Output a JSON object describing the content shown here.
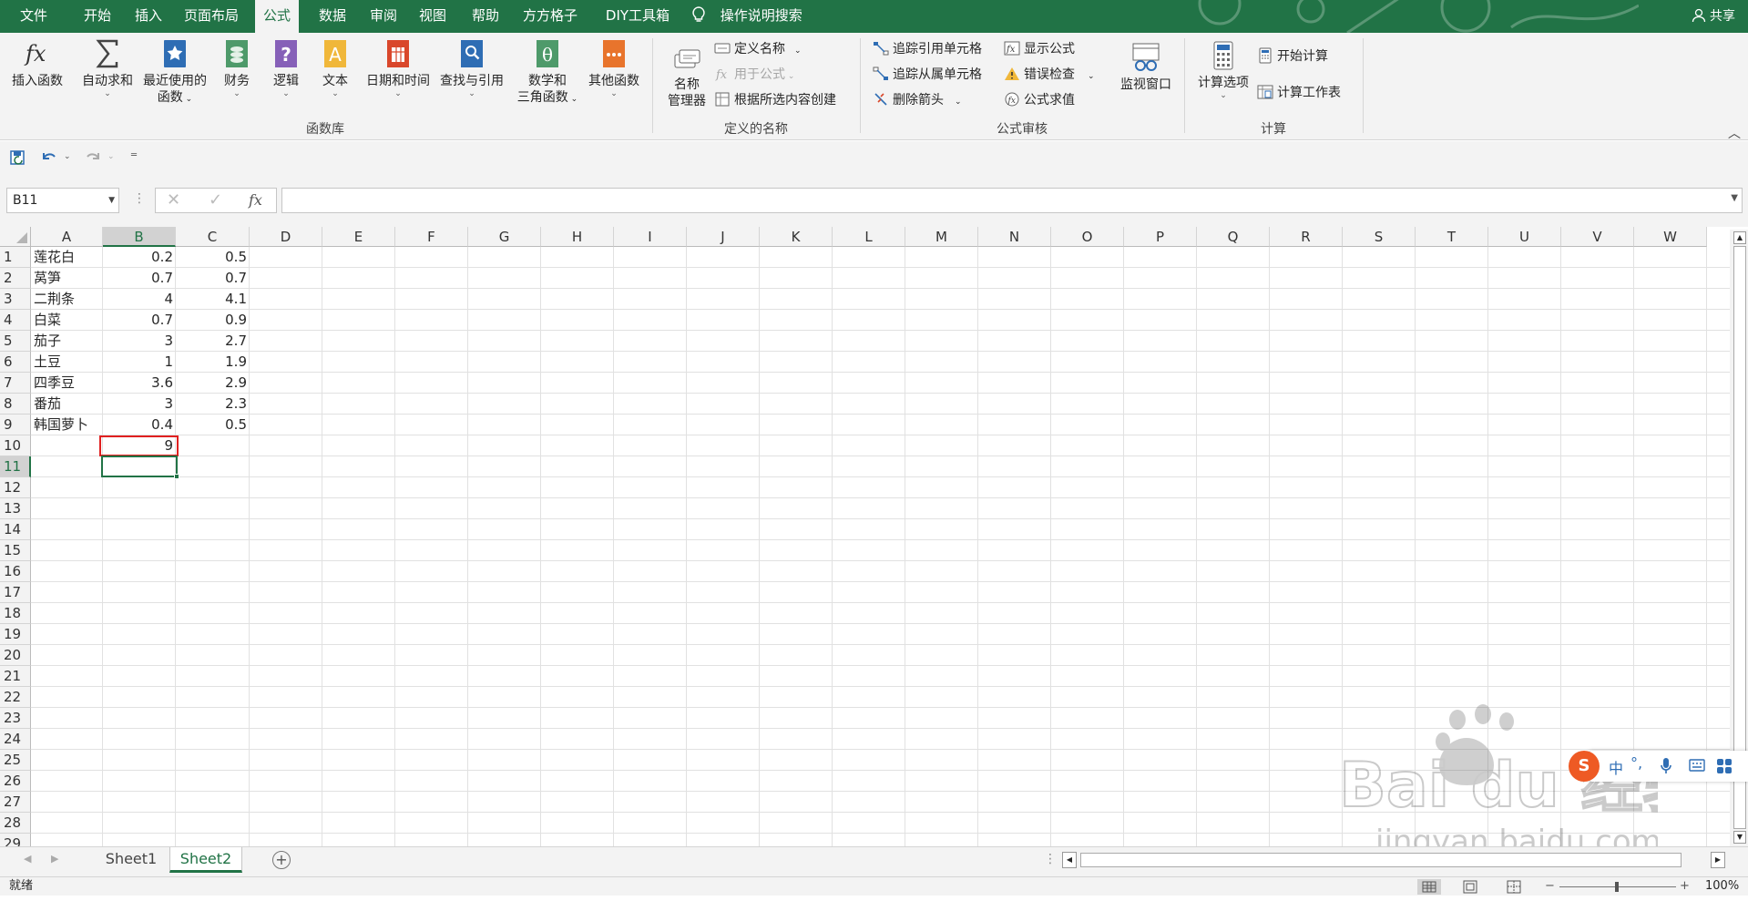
{
  "menubar": {
    "tabs": [
      {
        "label": "文件",
        "active": false
      },
      {
        "label": "开始",
        "active": false
      },
      {
        "label": "插入",
        "active": false
      },
      {
        "label": "页面布局",
        "active": false
      },
      {
        "label": "公式",
        "active": true
      },
      {
        "label": "数据",
        "active": false
      },
      {
        "label": "审阅",
        "active": false
      },
      {
        "label": "视图",
        "active": false
      },
      {
        "label": "帮助",
        "active": false
      },
      {
        "label": "方方格子",
        "active": false
      },
      {
        "label": "DIY工具箱",
        "active": false
      }
    ],
    "search_label": "操作说明搜索",
    "share_label": "共享",
    "accent_color": "#217346"
  },
  "ribbon": {
    "function_library": {
      "label": "函数库",
      "insert_function": "插入函数",
      "autosum": "自动求和",
      "recent_line1": "最近使用的",
      "recent_line2": "函数",
      "financial": "财务",
      "logical": "逻辑",
      "text": "文本",
      "datetime": "日期和时间",
      "lookup": "查找与引用",
      "math_line1": "数学和",
      "math_line2": "三角函数",
      "more": "其他函数"
    },
    "defined_names": {
      "label": "定义的名称",
      "name_manager_line1": "名称",
      "name_manager_line2": "管理器",
      "define_name": "定义名称",
      "use_in_formula": "用于公式",
      "create_from_selection": "根据所选内容创建"
    },
    "formula_auditing": {
      "label": "公式审核",
      "trace_precedents": "追踪引用单元格",
      "trace_dependents": "追踪从属单元格",
      "remove_arrows": "删除箭头",
      "show_formulas": "显示公式",
      "error_checking": "错误检查",
      "evaluate_formula": "公式求值",
      "watch_window": "监视窗口"
    },
    "calculation": {
      "label": "计算",
      "options": "计算选项",
      "calc_now": "开始计算",
      "calc_sheet": "计算工作表"
    }
  },
  "formula_bar": {
    "name_box": "B11",
    "fx": "fx",
    "value": ""
  },
  "sheet": {
    "columns": [
      "A",
      "B",
      "C",
      "D",
      "E",
      "F",
      "G",
      "H",
      "I",
      "J",
      "K",
      "L",
      "M",
      "N",
      "O",
      "P",
      "Q",
      "R",
      "S",
      "T",
      "U",
      "V",
      "W"
    ],
    "rows": [
      "1",
      "2",
      "3",
      "4",
      "5",
      "6",
      "7",
      "8",
      "9",
      "10",
      "11",
      "12",
      "13",
      "14",
      "15",
      "16",
      "17",
      "18",
      "19",
      "20",
      "21",
      "22",
      "23",
      "24",
      "25",
      "26",
      "27",
      "28",
      "29"
    ],
    "data": [
      {
        "a": "莲花白",
        "b": "0.2",
        "c": "0.5"
      },
      {
        "a": "莴笋",
        "b": "0.7",
        "c": "0.7"
      },
      {
        "a": "二荆条",
        "b": "4",
        "c": "4.1"
      },
      {
        "a": "白菜",
        "b": "0.7",
        "c": "0.9"
      },
      {
        "a": "茄子",
        "b": "3",
        "c": "2.7"
      },
      {
        "a": "土豆",
        "b": "1",
        "c": "1.9"
      },
      {
        "a": "四季豆",
        "b": "3.6",
        "c": "2.9"
      },
      {
        "a": "番茄",
        "b": "3",
        "c": "2.3"
      },
      {
        "a": "韩国萝卜",
        "b": "0.4",
        "c": "0.5"
      },
      {
        "a": "",
        "b": "9",
        "c": ""
      }
    ],
    "selected_cell": "B11",
    "highlight_cell": "B10",
    "highlight_color": "#e02020"
  },
  "tabs": {
    "sheets": [
      {
        "label": "Sheet1",
        "active": false
      },
      {
        "label": "Sheet2",
        "active": true
      }
    ]
  },
  "status": {
    "ready": "就绪",
    "zoom": "100%"
  },
  "watermark": {
    "brand": "Bai du 经验",
    "url": "jingyan.baidu.com"
  }
}
